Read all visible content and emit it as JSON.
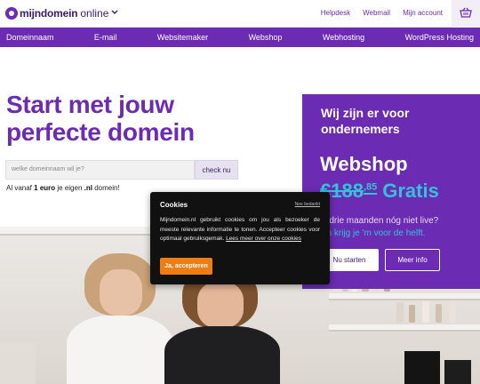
{
  "header": {
    "logo_text": "mijndomein",
    "logo_sub": "online",
    "links": [
      "Helpdesk",
      "Webmail",
      "Mijn account"
    ]
  },
  "nav": {
    "items": [
      "Domeinnaam",
      "E-mail",
      "Websitemaker",
      "Webshop",
      "Webhosting",
      "WordPress Hosting"
    ]
  },
  "hero": {
    "title_line1": "Start met jouw",
    "title_line2": "perfecte domein",
    "search_placeholder": "welke domeinnaam wil je?",
    "search_button": "check nu",
    "subline_pre": "Al vanaf ",
    "subline_price": "1 euro",
    "subline_mid": " je eigen ",
    "subline_tld": ".nl",
    "subline_post": " domein!"
  },
  "promo": {
    "heading_line1": "Wij zijn er voor",
    "heading_line2": "ondernemers",
    "product": "Webshop",
    "old_price_main": "€188",
    "old_price_cents": ",85",
    "new_price": "Gratis",
    "question": "e drie maanden nóg niet live?",
    "answer": "an krijg je 'm voor de helft.",
    "btn_primary": "Nu starten",
    "btn_secondary": "Meer info"
  },
  "cookie": {
    "title": "Cookies",
    "refuse": "Nee bedankt",
    "body": "Mijndomein.nl gebruikt cookies om jou als bezoeker de meeste relevante informatie te tonen. Accepteer cookies voor optimaal gebruiksgemak. ",
    "link": "Lees meer over onze cookies",
    "accept": "Ja, accepteren"
  },
  "colors": {
    "brand_purple": "#6b2bb3",
    "accent_teal": "#35c1d8",
    "accept_orange": "#ef7d14"
  }
}
